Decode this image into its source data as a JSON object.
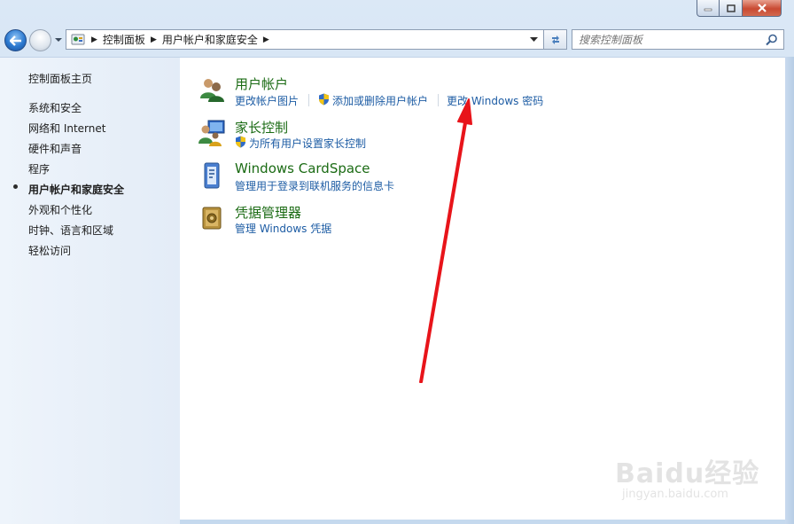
{
  "navigation": {
    "breadcrumbs": [
      "控制面板",
      "用户帐户和家庭安全"
    ]
  },
  "search": {
    "placeholder": "搜索控制面板"
  },
  "sidebar": {
    "home_label": "控制面板主页",
    "items": [
      {
        "label": "系统和安全",
        "active": false
      },
      {
        "label": "网络和 Internet",
        "active": false
      },
      {
        "label": "硬件和声音",
        "active": false
      },
      {
        "label": "程序",
        "active": false
      },
      {
        "label": "用户帐户和家庭安全",
        "active": true
      },
      {
        "label": "外观和个性化",
        "active": false
      },
      {
        "label": "时钟、语言和区域",
        "active": false
      },
      {
        "label": "轻松访问",
        "active": false
      }
    ]
  },
  "categories": [
    {
      "title": "用户帐户",
      "icon": "user-accounts-icon",
      "links": [
        "更改帐户图片",
        "添加或删除用户帐户",
        "更改 Windows 密码"
      ]
    },
    {
      "title": "家长控制",
      "icon": "parental-controls-icon",
      "links": [
        "为所有用户设置家长控制"
      ]
    },
    {
      "title": "Windows CardSpace",
      "icon": "cardspace-icon",
      "links": [
        "管理用于登录到联机服务的信息卡"
      ]
    },
    {
      "title": "凭据管理器",
      "icon": "credential-manager-icon",
      "links": [
        "管理 Windows 凭据"
      ]
    }
  ],
  "annotation": {
    "arrow_color": "#e8141a"
  },
  "watermark": {
    "brand": "Baidu经验",
    "sub": "jingyan.baidu.com"
  },
  "colors": {
    "title_green": "#1b6b14",
    "link_blue": "#1d5ca4"
  }
}
